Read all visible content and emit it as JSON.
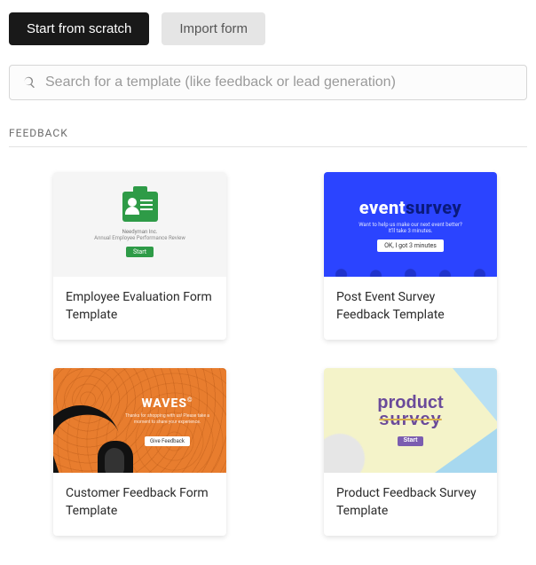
{
  "buttons": {
    "scratch": "Start from scratch",
    "import": "Import form"
  },
  "search": {
    "placeholder": "Search for a template (like feedback or lead generation)"
  },
  "section": {
    "label": "FEEDBACK"
  },
  "cards": {
    "c0": {
      "title": "Employee Evaluation Form Template",
      "preview": {
        "company": "Needyman Inc.",
        "subtitle": "Annual Employee Performance Review",
        "cta": "Start"
      }
    },
    "c1": {
      "title": "Post Event Survey Feedback Template",
      "preview": {
        "logo_light": "event",
        "logo_dark": "survey",
        "line1": "Want to help us make our next event better?",
        "line2": "It'll take 3 minutes.",
        "cta": "OK, I got 3 minutes"
      }
    },
    "c2": {
      "title": "Customer Feedback Form Template",
      "preview": {
        "logo": "WAVES",
        "logo_mark": "©",
        "sub": "Thanks for shopping with us! Please take a moment to share your experience.",
        "cta": "Give Feedback"
      }
    },
    "c3": {
      "title": "Product Feedback Survey Template",
      "preview": {
        "line1": "product",
        "line2": "survey",
        "cta": "Start"
      }
    }
  }
}
